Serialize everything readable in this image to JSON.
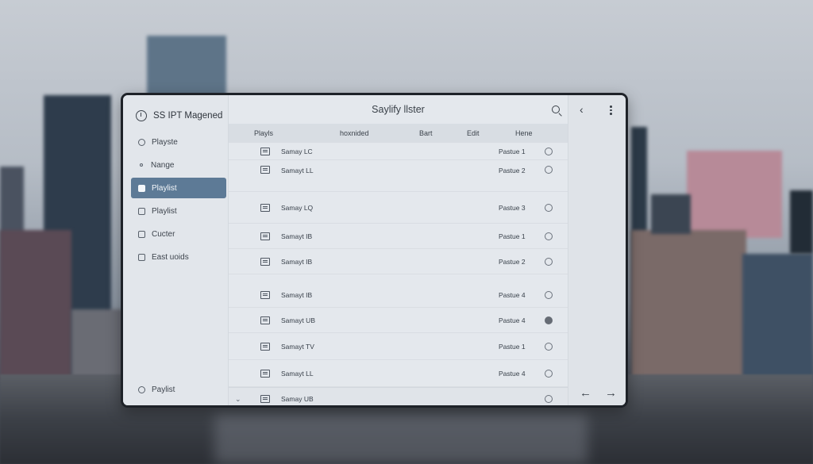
{
  "window": {
    "app_title": "SS IPT Magened",
    "main_title": "Saylify llster"
  },
  "sidebar": {
    "items": [
      {
        "label": "Playste",
        "icon": "globe-icon"
      },
      {
        "label": "Nange",
        "icon": "dot-icon"
      },
      {
        "label": "Playlist",
        "icon": "camera-icon",
        "active": true
      },
      {
        "label": "Playlist",
        "icon": "document-icon"
      },
      {
        "label": "Cucter",
        "icon": "folder-icon"
      },
      {
        "label": "East uoids",
        "icon": "download-icon"
      }
    ],
    "footer_label": "Paylist"
  },
  "columns": [
    "Playls",
    "hoxnided",
    "Bart",
    "Edit",
    "Hene"
  ],
  "rows": [
    {
      "name": "Samay LC",
      "position": "Pastue 1",
      "selected": false
    },
    {
      "name": "Samayt LL",
      "position": "Pastue 2",
      "selected": false
    },
    {
      "name": "Samay LQ",
      "position": "Pastue 3",
      "selected": false
    },
    {
      "name": "Samayt IB",
      "position": "Pastue 1",
      "selected": false
    },
    {
      "name": "Samayt IB",
      "position": "Pastue 2",
      "selected": false
    },
    {
      "name": "Samayt IB",
      "position": "Pastue 4",
      "selected": false
    },
    {
      "name": "Samayt UB",
      "position": "Pastue 4",
      "selected": true
    },
    {
      "name": "Samayt TV",
      "position": "Pastue 1",
      "selected": false
    },
    {
      "name": "Samayt LL",
      "position": "Pastue 4",
      "selected": false
    },
    {
      "name": "Samay UB",
      "position": "",
      "selected": false
    }
  ],
  "colors": {
    "accent": "#5d7a96",
    "window_bg": "#e3e7ec",
    "border": "#1e2228"
  }
}
